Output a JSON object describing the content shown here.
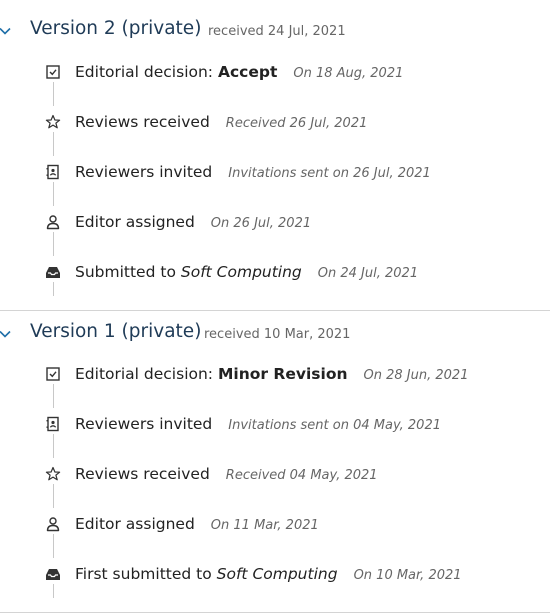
{
  "versions": [
    {
      "title": "Version 2 (private)",
      "received": "received 24 Jul, 2021",
      "events": [
        {
          "icon": "checkbox-icon",
          "label": "Editorial decision:",
          "value": "Accept",
          "date": "On 18 Aug, 2021"
        },
        {
          "icon": "star-icon",
          "label": "Reviews received",
          "value": "",
          "date": "Received 26 Jul, 2021"
        },
        {
          "icon": "contact-book-icon",
          "label": "Reviewers invited",
          "value": "",
          "date": "Invitations sent on 26 Jul, 2021"
        },
        {
          "icon": "person-icon",
          "label": "Editor assigned",
          "value": "",
          "date": "On 26 Jul, 2021"
        },
        {
          "icon": "inbox-icon",
          "label": "Submitted to",
          "value": "Soft Computing",
          "date": "On 24 Jul, 2021"
        }
      ]
    },
    {
      "title": "Version 1 (private)",
      "received": "received 10 Mar, 2021",
      "events": [
        {
          "icon": "checkbox-icon",
          "label": "Editorial decision:",
          "value": "Minor Revision",
          "date": "On 28 Jun, 2021"
        },
        {
          "icon": "contact-book-icon",
          "label": "Reviewers invited",
          "value": "",
          "date": "Invitations sent on 04 May, 2021"
        },
        {
          "icon": "star-icon",
          "label": "Reviews received",
          "value": "",
          "date": "Received 04 May, 2021"
        },
        {
          "icon": "person-icon",
          "label": "Editor assigned",
          "value": "",
          "date": "On 11 Mar, 2021"
        },
        {
          "icon": "inbox-icon",
          "label": "First submitted to",
          "value": "Soft Computing",
          "date": "On 10 Mar, 2021"
        }
      ]
    }
  ]
}
